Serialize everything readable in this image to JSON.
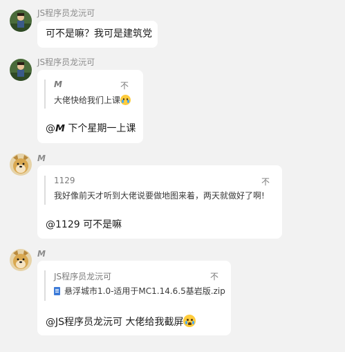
{
  "messages": [
    {
      "sender": "JS程序员龙沅可",
      "text": "可不是嘛？我可是建筑党"
    },
    {
      "sender": "JS程序员龙沅可",
      "quote": {
        "author": "𝙈",
        "text": "大佬快给我们上课",
        "close": "不"
      },
      "reply_mention": "@𝙈",
      "reply_text": "下个星期一上课"
    },
    {
      "sender": "𝙈",
      "quote": {
        "author": "1129",
        "text": "我好像前天才听到大佬说要做地图来着，两天就做好了啊!",
        "close": "不"
      },
      "reply_mention": "@1129",
      "reply_text": "可不是嘛"
    },
    {
      "sender": "𝙈",
      "quote": {
        "author": "JS程序员龙沅可",
        "file": "悬浮城市1.0-适用于MC1.14.6.5基岩版.zip",
        "close": "不"
      },
      "reply_mention": "@JS程序员龙沅可",
      "reply_text": "大佬给我截屏"
    }
  ],
  "icons": {
    "crying_emoji": "loudly-crying-face-emoji",
    "file": "file-icon"
  }
}
